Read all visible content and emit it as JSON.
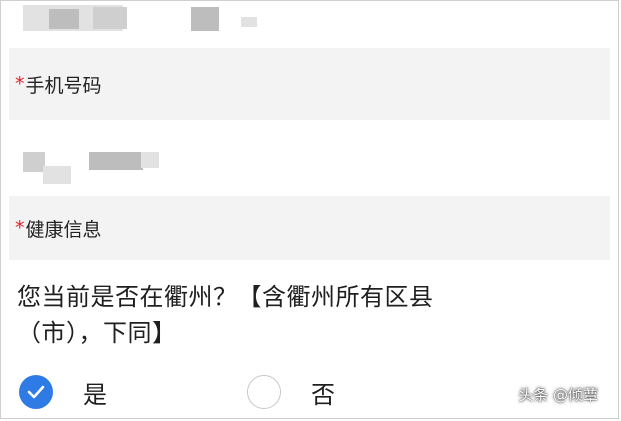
{
  "form": {
    "phone_section": {
      "required_mark": "*",
      "label": "手机号码"
    },
    "health_section": {
      "required_mark": "*",
      "label": "健康信息"
    },
    "question": {
      "line1": "您当前是否在衢州？【含衢州所有区县",
      "line2": "（市），下同】"
    },
    "options": [
      {
        "label": "是",
        "selected": true
      },
      {
        "label": "否",
        "selected": false
      }
    ]
  },
  "watermark": "头条 @倾蕈",
  "colors": {
    "accent": "#2f7be5",
    "required": "#e0202a",
    "section_bg": "#f3f3f3"
  }
}
